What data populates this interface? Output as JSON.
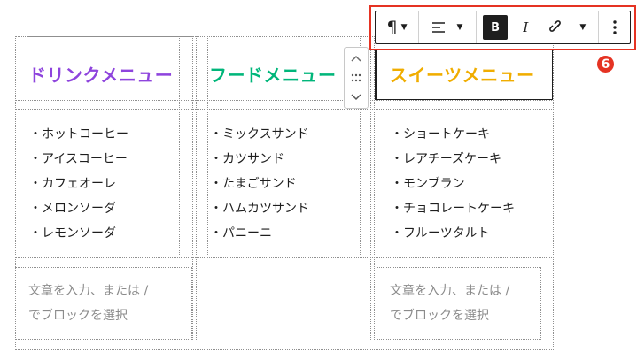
{
  "columns": [
    {
      "title": "ドリンクメニュー",
      "color": "#8e44dd",
      "items": [
        "・ホットコーヒー",
        "・アイスコーヒー",
        "・カフェオーレ",
        "・メロンソーダ",
        "・レモンソーダ"
      ],
      "placeholder_lines": [
        "文章を入力、または /",
        "でブロックを選択"
      ]
    },
    {
      "title": "フードメニュー",
      "color": "#00b67a",
      "items": [
        "・ミックスサンド",
        "・カツサンド",
        "・たまごサンド",
        "・ハムカツサンド",
        "・パニーニ"
      ]
    },
    {
      "title": "スイーツメニュー",
      "color": "#f0ad00",
      "items": [
        "・ショートケーキ",
        "・レアチーズケーキ",
        "・モンブラン",
        "・チョコレートケーキ",
        "・フルーツタルト"
      ],
      "placeholder_lines": [
        "文章を入力、または /",
        "でブロックを選択"
      ]
    }
  ],
  "toolbar": {
    "paragraph_icon": "pilcrow-icon",
    "align_icon": "align-left-icon",
    "bold_label": "B",
    "italic_label": "I",
    "link_icon": "link-icon",
    "more_icon": "more-vertical-icon"
  },
  "annotation": {
    "badge": "❻",
    "color": "#e53323"
  }
}
